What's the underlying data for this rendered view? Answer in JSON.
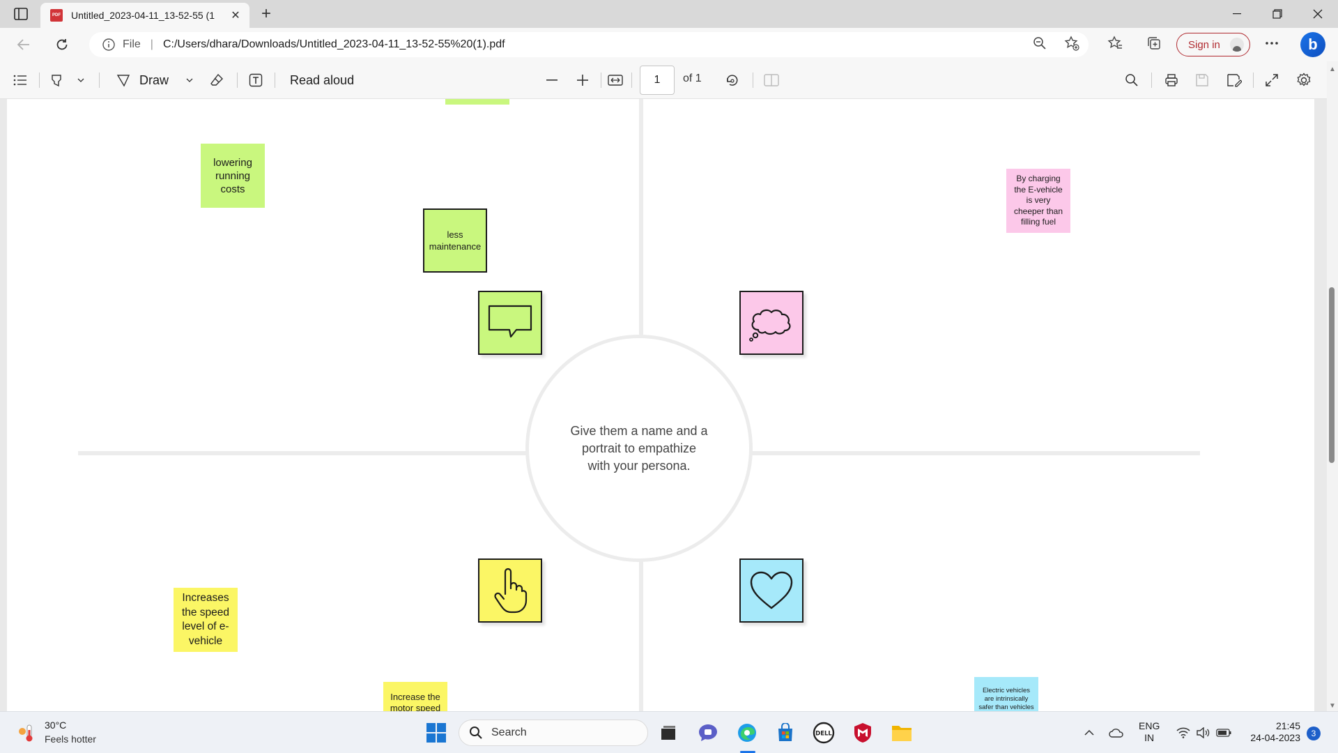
{
  "browser": {
    "tab_title": "Untitled_2023-04-11_13-52-55 (1",
    "file_label": "File",
    "url": "C:/Users/dhara/Downloads/Untitled_2023-04-11_13-52-55%20(1).pdf",
    "sign_in": "Sign in"
  },
  "pdf_toolbar": {
    "draw_label": "Draw",
    "read_aloud": "Read aloud",
    "page_number": "1",
    "page_of": "of 1"
  },
  "canvas": {
    "center_text": "Give them a name and a portrait to empathize with your persona.",
    "notes": {
      "lowering_costs": "lowering running costs",
      "less_maintenance": "less maintenance",
      "charging": "By charging the E-vehicle is very cheeper than filling fuel",
      "speed_level": "Increases the speed level of e-vehicle",
      "motor_speed": "Increase the motor speed",
      "safer": "Electric vehicles are intrinsically safer than vehicles"
    },
    "colors": {
      "green": "#c9f77e",
      "pink": "#fcc8e9",
      "yellow": "#fbf665",
      "blue": "#a6e9fa"
    }
  },
  "taskbar": {
    "temperature": "30°C",
    "weather_desc": "Feels hotter",
    "search_label": "Search",
    "lang_1": "ENG",
    "lang_2": "IN",
    "time": "21:45",
    "date": "24-04-2023",
    "notification_count": "3"
  }
}
